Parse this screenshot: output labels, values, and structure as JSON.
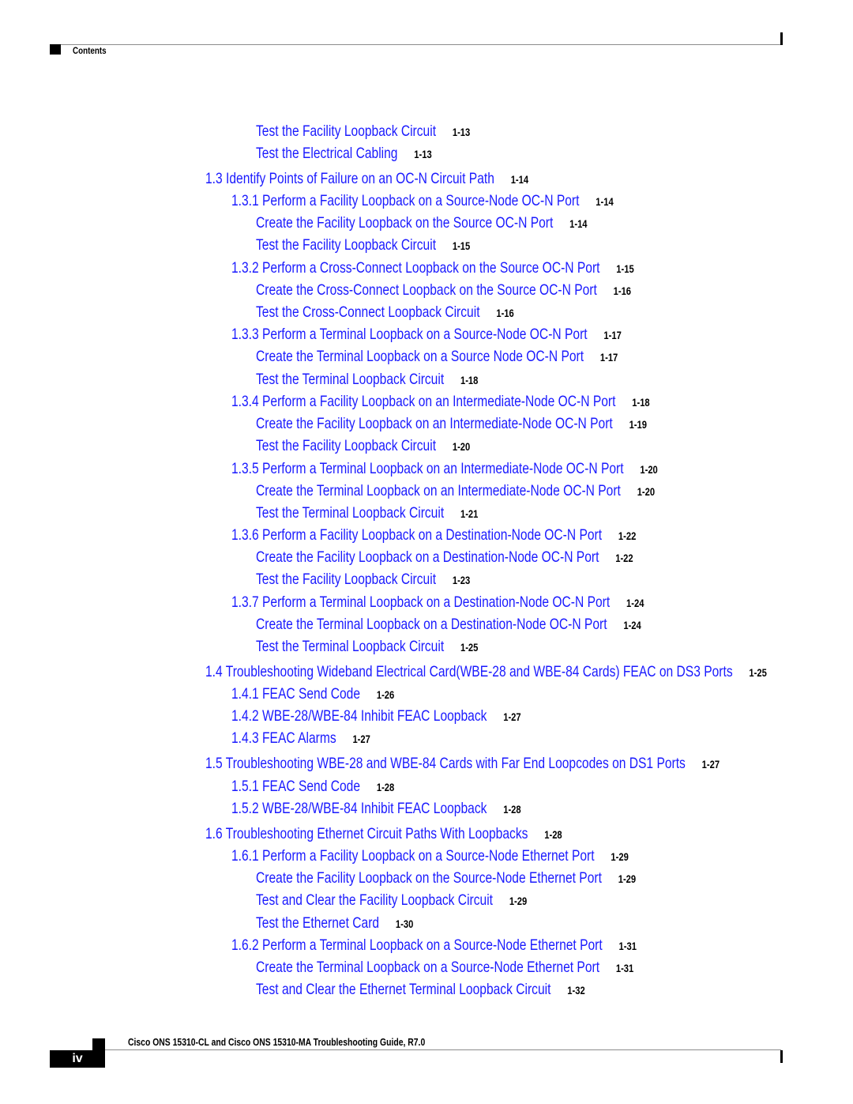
{
  "header": {
    "section_label": "Contents"
  },
  "toc": [
    {
      "level": 3,
      "title": "Test the Facility Loopback Circuit",
      "page": "1-13"
    },
    {
      "level": 3,
      "title": "Test the Electrical Cabling",
      "page": "1-13"
    },
    {
      "level": 1,
      "title": "1.3  Identify Points of Failure on an OC-N Circuit Path",
      "page": "1-14"
    },
    {
      "level": 2,
      "title": "1.3.1  Perform a Facility Loopback on a Source-Node OC-N Port",
      "page": "1-14"
    },
    {
      "level": 3,
      "title": "Create the Facility Loopback on the Source OC-N Port",
      "page": "1-14"
    },
    {
      "level": 3,
      "title": "Test the Facility Loopback Circuit",
      "page": "1-15"
    },
    {
      "level": 2,
      "title": "1.3.2  Perform a Cross-Connect Loopback on the Source OC-N Port",
      "page": "1-15"
    },
    {
      "level": 3,
      "title": "Create the Cross-Connect Loopback on the Source OC-N Port",
      "page": "1-16"
    },
    {
      "level": 3,
      "title": "Test the Cross-Connect Loopback Circuit",
      "page": "1-16"
    },
    {
      "level": 2,
      "title": "1.3.3  Perform a Terminal Loopback on a Source-Node OC-N Port",
      "page": "1-17"
    },
    {
      "level": 3,
      "title": "Create the Terminal Loopback on a Source Node OC-N Port",
      "page": "1-17"
    },
    {
      "level": 3,
      "title": "Test the Terminal Loopback Circuit",
      "page": "1-18"
    },
    {
      "level": 2,
      "title": "1.3.4  Perform a Facility Loopback on an Intermediate-Node OC-N Port",
      "page": "1-18"
    },
    {
      "level": 3,
      "title": "Create the Facility Loopback on an Intermediate-Node OC-N Port",
      "page": "1-19"
    },
    {
      "level": 3,
      "title": "Test the Facility Loopback Circuit",
      "page": "1-20"
    },
    {
      "level": 2,
      "title": "1.3.5  Perform a Terminal Loopback on an Intermediate-Node OC-N Port",
      "page": "1-20"
    },
    {
      "level": 3,
      "title": "Create the Terminal Loopback on an Intermediate-Node OC-N Port",
      "page": "1-20"
    },
    {
      "level": 3,
      "title": "Test the Terminal Loopback Circuit",
      "page": "1-21"
    },
    {
      "level": 2,
      "title": "1.3.6  Perform a Facility Loopback on a Destination-Node OC-N Port",
      "page": "1-22"
    },
    {
      "level": 3,
      "title": "Create the Facility Loopback on a Destination-Node OC-N Port",
      "page": "1-22"
    },
    {
      "level": 3,
      "title": "Test the Facility Loopback Circuit",
      "page": "1-23"
    },
    {
      "level": 2,
      "title": "1.3.7  Perform a Terminal Loopback on a Destination-Node OC-N Port",
      "page": "1-24"
    },
    {
      "level": 3,
      "title": "Create the Terminal Loopback on a Destination-Node OC-N Port",
      "page": "1-24"
    },
    {
      "level": 3,
      "title": "Test the Terminal Loopback Circuit",
      "page": "1-25"
    },
    {
      "level": 1,
      "title": "1.4  Troubleshooting Wideband Electrical Card(WBE-28 and WBE-84 Cards) FEAC on DS3 Ports",
      "page": "1-25"
    },
    {
      "level": 2,
      "title": "1.4.1  FEAC Send Code",
      "page": "1-26"
    },
    {
      "level": 2,
      "title": "1.4.2  WBE-28/WBE-84 Inhibit FEAC Loopback",
      "page": "1-27"
    },
    {
      "level": 2,
      "title": "1.4.3  FEAC Alarms",
      "page": "1-27"
    },
    {
      "level": 1,
      "title": "1.5  Troubleshooting WBE-28 and WBE-84 Cards with Far End Loopcodes on  DS1 Ports",
      "page": "1-27"
    },
    {
      "level": 2,
      "title": "1.5.1  FEAC Send Code",
      "page": "1-28"
    },
    {
      "level": 2,
      "title": "1.5.2  WBE-28/WBE-84 Inhibit FEAC Loopback",
      "page": "1-28"
    },
    {
      "level": 1,
      "title": "1.6  Troubleshooting Ethernet Circuit Paths With Loopbacks",
      "page": "1-28"
    },
    {
      "level": 2,
      "title": "1.6.1  Perform a Facility Loopback on a Source-Node Ethernet Port",
      "page": "1-29"
    },
    {
      "level": 3,
      "title": "Create the Facility Loopback on the Source-Node Ethernet Port",
      "page": "1-29"
    },
    {
      "level": 3,
      "title": "Test and Clear the Facility Loopback Circuit",
      "page": "1-29"
    },
    {
      "level": 3,
      "title": "Test the Ethernet Card",
      "page": "1-30"
    },
    {
      "level": 2,
      "title": "1.6.2  Perform a Terminal Loopback on a Source-Node Ethernet Port",
      "page": "1-31"
    },
    {
      "level": 3,
      "title": "Create the Terminal Loopback on a Source-Node Ethernet Port",
      "page": "1-31"
    },
    {
      "level": 3,
      "title": "Test and Clear the Ethernet Terminal Loopback Circuit",
      "page": "1-32"
    }
  ],
  "footer": {
    "doc_title": "Cisco ONS 15310-CL and Cisco ONS 15310-MA Troubleshooting Guide, R7.0",
    "page_number": "iv"
  },
  "colors": {
    "link": "#1a1aff",
    "page_ref": "#000000",
    "rule": "#8c8c8c"
  }
}
